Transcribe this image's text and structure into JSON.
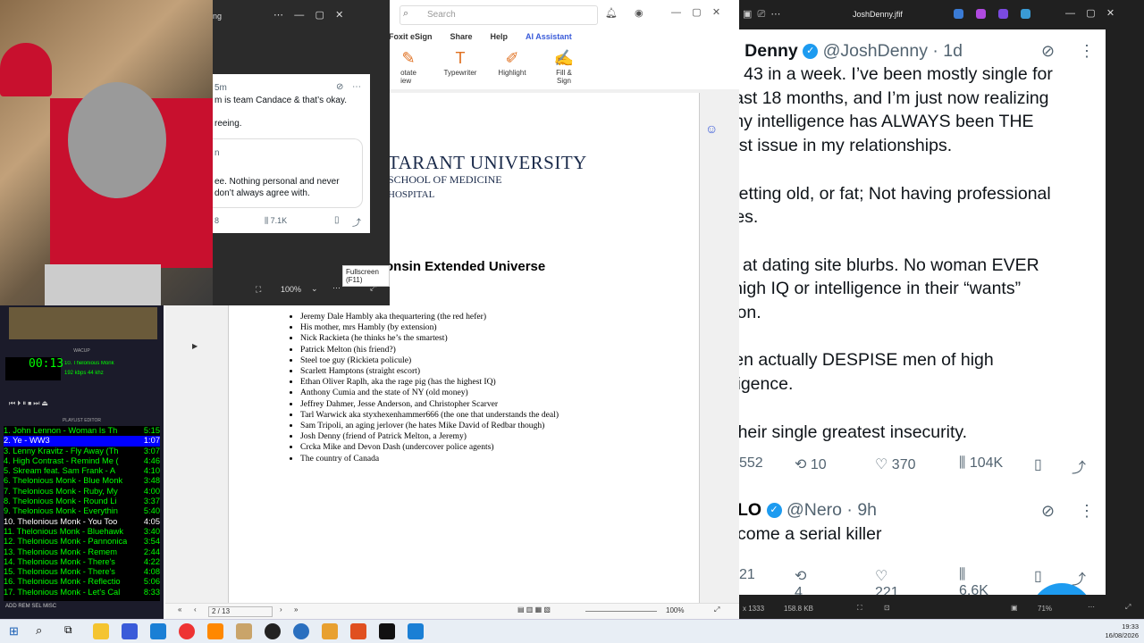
{
  "pdf": {
    "search_placeholder": "Search",
    "menus": [
      "Foxit eSign",
      "Share",
      "Help",
      "AI Assistant"
    ],
    "tools": [
      {
        "label": "otate\niew",
        "icon": "annotate-icon"
      },
      {
        "label": "Typewriter",
        "icon": "typewriter-icon"
      },
      {
        "label": "Highlight",
        "icon": "highlight-icon"
      },
      {
        "label": "Fill &\nSign",
        "icon": "fill-sign-icon"
      }
    ],
    "university": "TARANT UNIVERSITY",
    "school": "SCHOOL OF MEDICINE",
    "hospital": "HOSPITAL",
    "doc_title": "onsin Extended Universe",
    "items": [
      "Jeremy Dale Hambly aka thequartering (the red hefer)",
      "His mother, mrs Hambly (by extension)",
      "Nick Rackieta (he thinks he’s the smartest)",
      "Patrick Melton (his friend?)",
      "Steel toe guy (Rickieta policule)",
      "Scarlett Hamptons (straight escort)",
      "Ethan Oliver Raplh, aka the rage pig (has the highest IQ)",
      "Anthony Cumia and the state of NY (old money)",
      "Jeffrey Dahmer, Jesse Anderson, and Christopher Scarver",
      "Tarl Warwick aka styxhexenhammer666 (the one that understands the deal)",
      "Sam Tripoli, an aging jerlover (he hates Mike David of Redbar though)",
      "Josh Denny (friend of Patrick Melton, a Jeremy)",
      "Crcka Mike and Devon Dash (undercover police agents)",
      "The country of Canada"
    ],
    "page_indicator": "2 / 13",
    "zoom": "100%",
    "tooltip": "Fullscreen (F11)"
  },
  "mini": {
    "title_frag": "ng",
    "time_frag": "5m",
    "line1": "m is team Candace & that’s okay.",
    "line2": "reeing.",
    "quote_a": "n",
    "quote1": "ee.  Nothing personal and never",
    "quote2": "don’t always agree with.",
    "reply_frag": "8",
    "views": "7.1K",
    "zoom": "100%"
  },
  "image_viewer": {
    "title": "JoshDenny.jfif",
    "status_left": "x 1333",
    "filesize": "158.8 KB",
    "zoom": "71%"
  },
  "tweet1": {
    "name": "sh Denny",
    "handle": "@JoshDenny · 1d",
    "text": "be 43 in a week. I’ve been mostly single for\n past 18 months, and I’m just now realizing\nt my intelligence has ALWAYS been THE\ngest issue in my relationships.\n\nt getting old, or fat; Not having professional\nures.\n\nok at dating site blurbs. No woman EVER\ns high IQ or intelligence in their “wants”\nction.\n\nmen actually DESPISE men of high\nelligence.\n\ns their single greatest insecurity.",
    "replies": "552",
    "reposts": "10",
    "likes": "370",
    "views": "104K"
  },
  "tweet2": {
    "name": "LO",
    "handle": "@Nero · 9h",
    "text": "come a serial killer",
    "replies": "21",
    "reposts": "4",
    "likes": "221",
    "views": "6,6K"
  },
  "winamp": {
    "time": "00:13",
    "track": "10. Thelonious Monk",
    "kbps": "192",
    "khz": "44",
    "header": "WACUP",
    "playlist_header": "PLAYLIST EDITOR",
    "playlist": [
      {
        "t": "1. John Lennon - Woman Is Th",
        "d": "5:15"
      },
      {
        "t": "2. Ye - WW3",
        "d": "1:07"
      },
      {
        "t": "3. Lenny Kravitz - Fly Away (Th",
        "d": "3:07"
      },
      {
        "t": "4. High Contrast - Remind Me (",
        "d": "4:46"
      },
      {
        "t": "5. Skream feat. Sam Frank - A",
        "d": "4:10"
      },
      {
        "t": "6. Thelonious Monk - Blue Monk",
        "d": "3:48"
      },
      {
        "t": "7. Thelonious Monk - Ruby, My",
        "d": "4:00"
      },
      {
        "t": "8. Thelonious Monk - Round Li",
        "d": "3:37"
      },
      {
        "t": "9. Thelonious Monk - Everythin",
        "d": "5:40"
      },
      {
        "t": "10. Thelonious Monk - You Too",
        "d": "4:05"
      },
      {
        "t": "11. Thelonious Monk - Bluehawk",
        "d": "3:40"
      },
      {
        "t": "12. Thelonious Monk - Pannonica",
        "d": "3:54"
      },
      {
        "t": "13. Thelonious Monk - Remem",
        "d": "2:44"
      },
      {
        "t": "14. Thelonious Monk - There's",
        "d": "4:22"
      },
      {
        "t": "15. Thelonious Monk - There's",
        "d": "4:08"
      },
      {
        "t": "16. Thelonious Monk - Reflectio",
        "d": "5:06"
      },
      {
        "t": "17. Thelonious Monk - Let's Cal",
        "d": "8:33"
      }
    ]
  },
  "taskbar": {
    "time": "19:33",
    "date": "16/08/2026"
  }
}
